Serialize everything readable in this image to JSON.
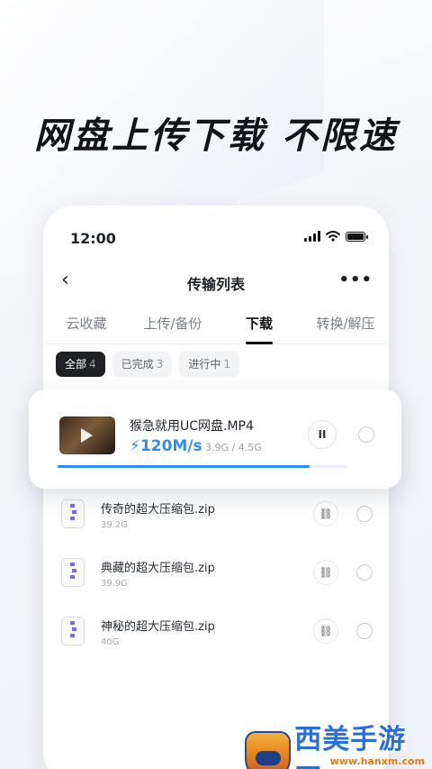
{
  "headline": "网盘上传下载 不限速",
  "status_bar": {
    "time": "12:00"
  },
  "nav": {
    "back_glyph": "‹",
    "title": "传输列表",
    "more_glyph": "•••"
  },
  "tabs": [
    {
      "label": "云收藏",
      "active": false
    },
    {
      "label": "上传/备份",
      "active": false
    },
    {
      "label": "下载",
      "active": true
    },
    {
      "label": "转换/解压",
      "active": false
    }
  ],
  "filters": [
    {
      "label": "全部",
      "count": "4",
      "active": true
    },
    {
      "label": "已完成",
      "count": "3",
      "active": false
    },
    {
      "label": "进行中",
      "count": "1",
      "active": false
    }
  ],
  "active_download": {
    "name": "猴急就用UC网盘.MP4",
    "speed": "120M/s",
    "size": "3.9G / 4.5G",
    "progress": 0.87,
    "pause_glyph": "II"
  },
  "completed_downloads": [
    {
      "name": "传奇的超大压缩包.zip",
      "size": "39.2G"
    },
    {
      "name": "典藏的超大压缩包.zip",
      "size": "39.9G"
    },
    {
      "name": "神秘的超大压缩包.zip",
      "size": "40G"
    }
  ],
  "watermark": {
    "brand": "西美手游网",
    "url": "www.hanxm.com"
  },
  "colors": {
    "accent": "#2f8cf0",
    "zip_icon": "#7b68ee",
    "watermark_blue": "#2a6fd8",
    "watermark_orange": "#e37a1f"
  },
  "icons": {
    "link": "link-icon",
    "pause": "pause-icon",
    "zip": "zip-file-icon"
  }
}
